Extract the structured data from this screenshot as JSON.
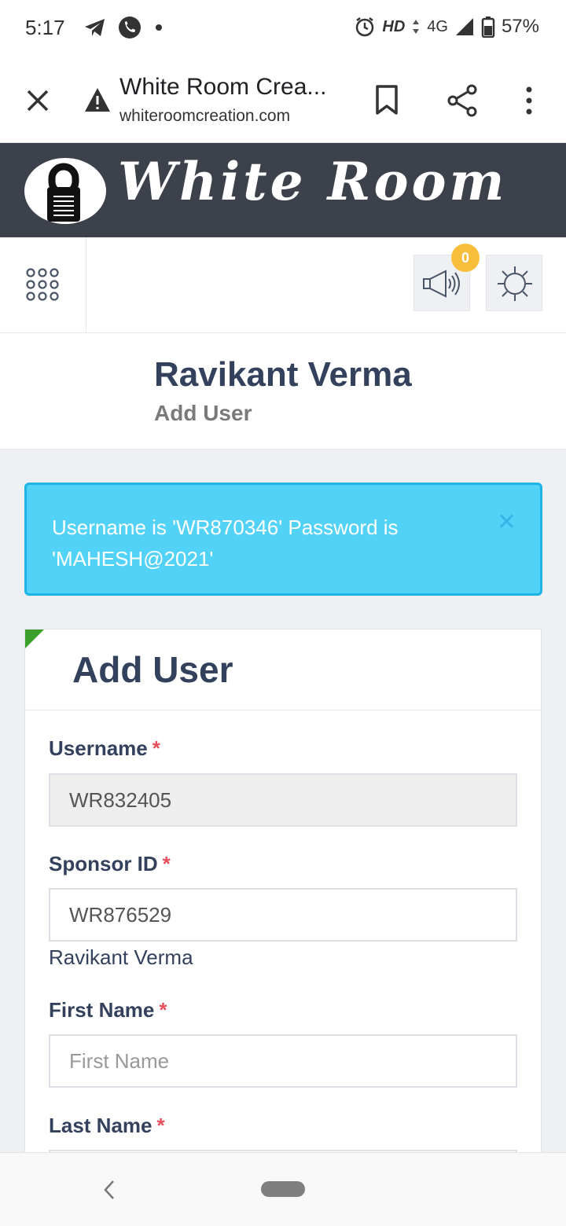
{
  "status_bar": {
    "time": "5:17",
    "network_hd": "HD",
    "network_type": "4G",
    "battery": "57%"
  },
  "browser": {
    "page_title": "White Room Crea...",
    "page_url": "whiteroomcreation.com"
  },
  "brand": {
    "name": "White Room"
  },
  "topnav": {
    "notification_count": "0"
  },
  "header": {
    "user_name": "Ravikant Verma",
    "subtitle": "Add User"
  },
  "alert": {
    "message": "Username is 'WR870346' Password is 'MAHESH@2021'",
    "close_glyph": "✕"
  },
  "form": {
    "title": "Add User",
    "username": {
      "label": "Username",
      "required": "*",
      "value": "WR832405"
    },
    "sponsor_id": {
      "label": "Sponsor ID",
      "required": "*",
      "value": "WR876529",
      "sponsor_name": "Ravikant Verma"
    },
    "first_name": {
      "label": "First Name",
      "required": "*",
      "placeholder": "First Name"
    },
    "last_name": {
      "label": "Last Name",
      "required": "*"
    }
  },
  "colors": {
    "banner": "#3c414b",
    "heading": "#33415c",
    "alert_bg": "#53d2f7",
    "required": "#e7505a",
    "badge": "#f7be3b"
  }
}
